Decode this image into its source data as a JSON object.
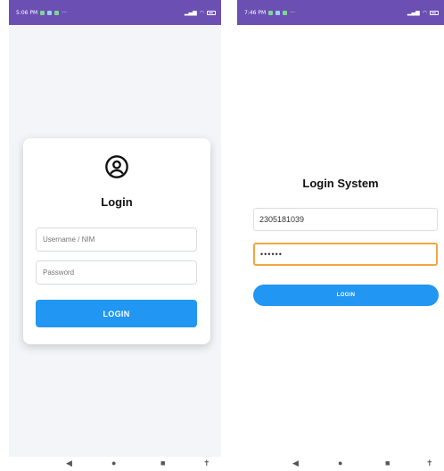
{
  "left_screen": {
    "status_time": "5:06 PM",
    "card": {
      "title": "Login",
      "username_placeholder": "Username / NIM",
      "password_placeholder": "Password",
      "login_button": "LOGIN"
    }
  },
  "right_screen": {
    "status_time": "7:46 PM",
    "title": "Login System",
    "nim_value": "2305181039",
    "password_value": "••••••",
    "login_button": "LOGIN"
  },
  "colors": {
    "status_bar": "#6b4fb3",
    "primary_button": "#2196f3",
    "focused_field_border": "#f2a541",
    "left_background": "#f3f5f8"
  },
  "icons": [
    "user-circle-icon",
    "back-icon",
    "home-icon",
    "recents-icon",
    "accessibility-icon",
    "wifi-icon",
    "battery-icon"
  ]
}
